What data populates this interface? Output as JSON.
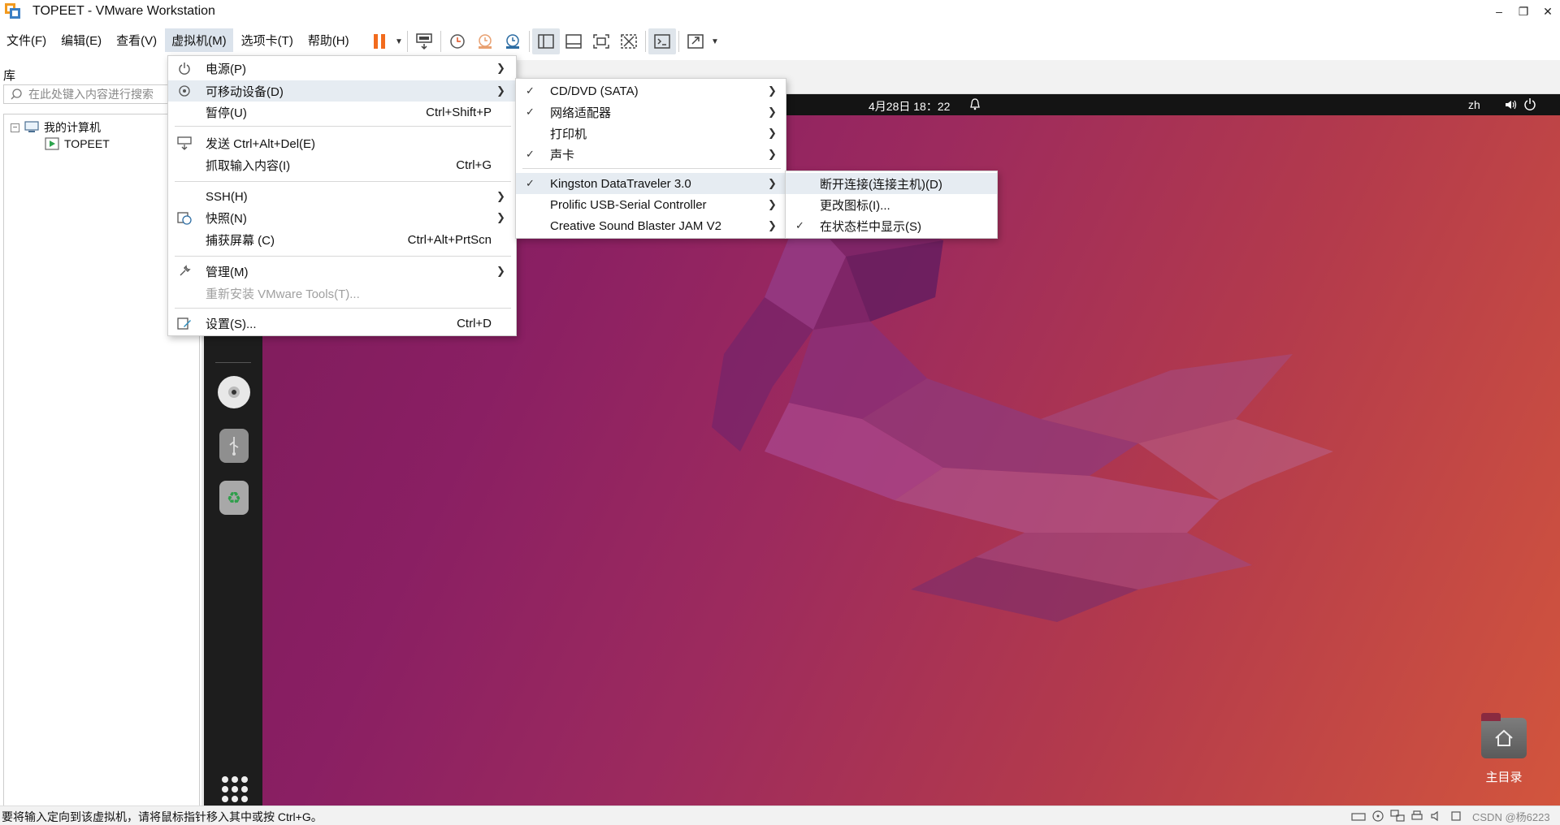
{
  "window": {
    "title": "TOPEET - VMware Workstation"
  },
  "menubar": {
    "items": [
      {
        "label": "文件(F)"
      },
      {
        "label": "编辑(E)"
      },
      {
        "label": "查看(V)"
      },
      {
        "label": "虚拟机(M)"
      },
      {
        "label": "选项卡(T)"
      },
      {
        "label": "帮助(H)"
      }
    ]
  },
  "library": {
    "label": "库",
    "search_placeholder": "在此处键入内容进行搜索",
    "tree": {
      "root": "我的计算机",
      "vm": "TOPEET"
    }
  },
  "vm_menu": {
    "items": [
      {
        "label": "电源(P)",
        "shortcut": "",
        "submenu": true
      },
      {
        "label": "可移动设备(D)",
        "shortcut": "",
        "submenu": true
      },
      {
        "label": "暂停(U)",
        "shortcut": "Ctrl+Shift+P",
        "submenu": false
      },
      {
        "label": "发送 Ctrl+Alt+Del(E)",
        "shortcut": "",
        "submenu": false
      },
      {
        "label": "抓取输入内容(I)",
        "shortcut": "Ctrl+G",
        "submenu": false
      },
      {
        "label": "SSH(H)",
        "shortcut": "",
        "submenu": true
      },
      {
        "label": "快照(N)",
        "shortcut": "",
        "submenu": true
      },
      {
        "label": "捕获屏幕 (C)",
        "shortcut": "Ctrl+Alt+PrtScn",
        "submenu": false
      },
      {
        "label": "管理(M)",
        "shortcut": "",
        "submenu": true
      },
      {
        "label": "重新安装 VMware Tools(T)...",
        "shortcut": "",
        "submenu": false,
        "disabled": true
      },
      {
        "label": "设置(S)...",
        "shortcut": "Ctrl+D",
        "submenu": false
      }
    ]
  },
  "removable_menu": {
    "items": [
      {
        "label": "CD/DVD (SATA)",
        "checked": true
      },
      {
        "label": "网络适配器",
        "checked": true
      },
      {
        "label": "打印机",
        "checked": false
      },
      {
        "label": "声卡",
        "checked": true
      },
      {
        "label": "Kingston DataTraveler 3.0",
        "checked": true
      },
      {
        "label": "Prolific USB-Serial Controller",
        "checked": false
      },
      {
        "label": "Creative Sound Blaster JAM V2",
        "checked": false
      }
    ]
  },
  "device_menu": {
    "items": [
      {
        "label": "断开连接(连接主机)(D)",
        "checked": false
      },
      {
        "label": "更改图标(I)...",
        "checked": false
      },
      {
        "label": "在状态栏中显示(S)",
        "checked": true
      }
    ]
  },
  "guest": {
    "clock": "4月28日 18：22",
    "lang": "zh",
    "home_label": "主目录"
  },
  "status": {
    "message": "要将输入定向到该虚拟机，请将鼠标指针移入其中或按 Ctrl+G。",
    "watermark": "CSDN @杨6223"
  },
  "colors": {
    "accent_pause": "#f26b1d",
    "ubuntu_bg": "#8a1f63",
    "menu_highlight": "#e6ecf2"
  }
}
